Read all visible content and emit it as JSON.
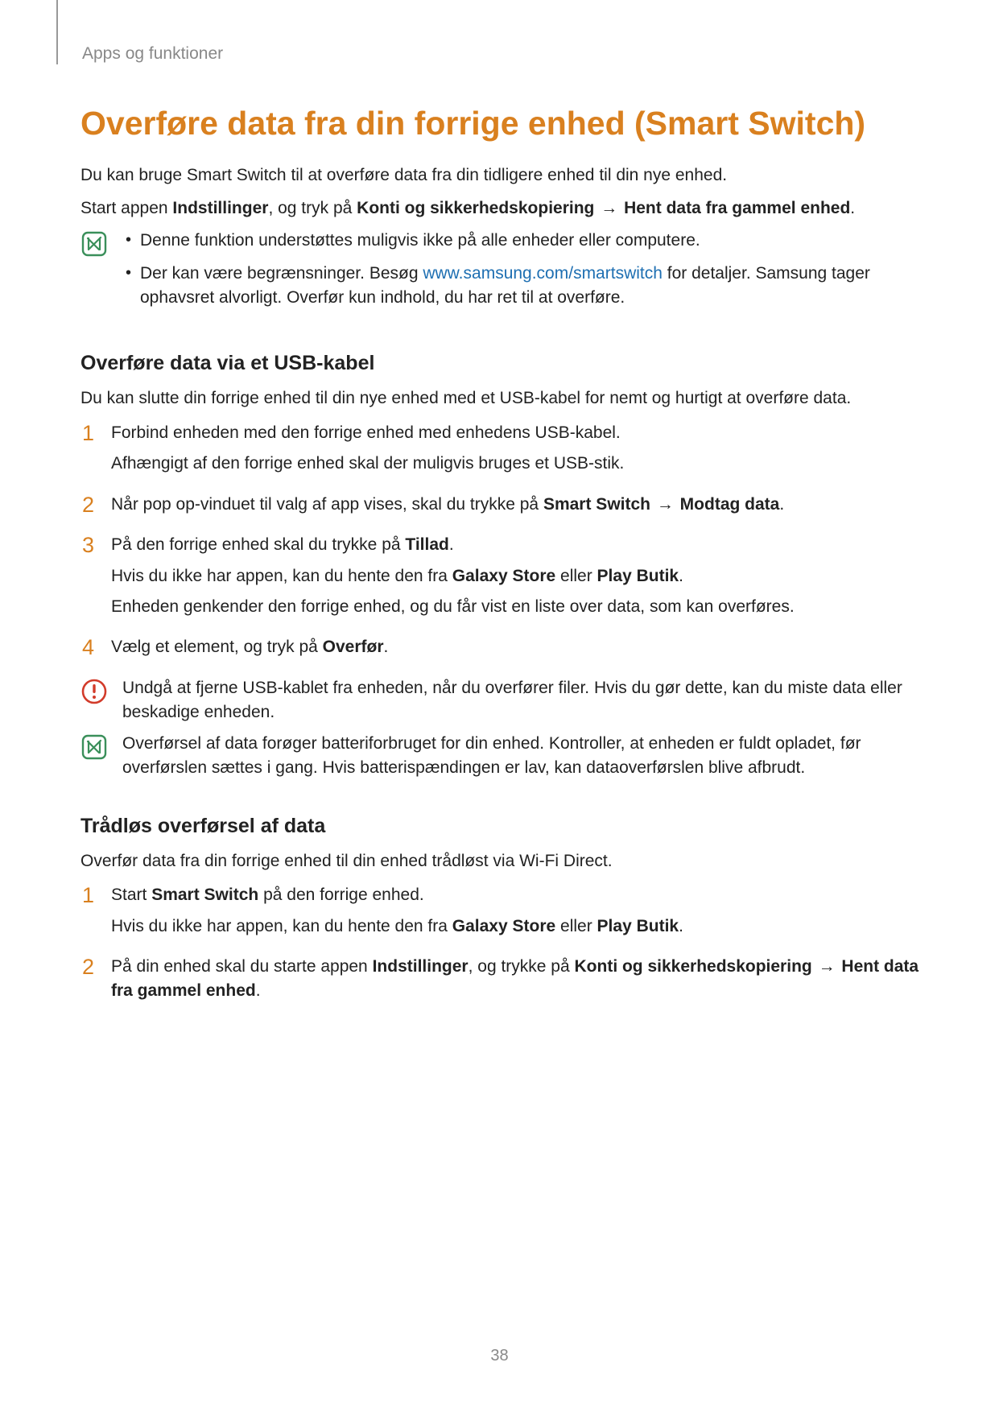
{
  "breadcrumb": "Apps og funktioner",
  "title": "Overføre data fra din forrige enhed (Smart Switch)",
  "intro1": "Du kan bruge Smart Switch til at overføre data fra din tidligere enhed til din nye enhed.",
  "intro2_pre": "Start appen ",
  "intro2_b1": "Indstillinger",
  "intro2_mid": ", og tryk på ",
  "intro2_b2": "Konti og sikkerhedskopiering",
  "arrow1": " → ",
  "intro2_b3": "Hent data fra gammel enhed",
  "intro2_end": ".",
  "note1_bullet1": "Denne funktion understøttes muligvis ikke på alle enheder eller computere.",
  "note1_bullet2_pre": "Der kan være begrænsninger. Besøg ",
  "note1_bullet2_link": "www.samsung.com/smartswitch",
  "note1_bullet2_post": " for detaljer. Samsung tager ophavsret alvorligt. Overfør kun indhold, du har ret til at overføre.",
  "section1_heading": "Overføre data via et USB-kabel",
  "section1_intro": "Du kan slutte din forrige enhed til din nye enhed med et USB-kabel for nemt og hurtigt at overføre data.",
  "s1_step1a": "Forbind enheden med den forrige enhed med enhedens USB-kabel.",
  "s1_step1b": "Afhængigt af den forrige enhed skal der muligvis bruges et USB-stik.",
  "s1_step2_pre": "Når pop op-vinduet til valg af app vises, skal du trykke på ",
  "s1_step2_b1": "Smart Switch",
  "s1_step2_arrow": " → ",
  "s1_step2_b2": "Modtag data",
  "s1_step2_end": ".",
  "s1_step3_pre": "På den forrige enhed skal du trykke på ",
  "s1_step3_b1": "Tillad",
  "s1_step3_mid": ".",
  "s1_step3_sub_pre": "Hvis du ikke har appen, kan du hente den fra ",
  "s1_step3_sub_b1": "Galaxy Store",
  "s1_step3_sub_mid": " eller ",
  "s1_step3_sub_b2": "Play Butik",
  "s1_step3_sub_end": ".",
  "s1_step3_sub2": "Enheden genkender den forrige enhed, og du får vist en liste over data, som kan overføres.",
  "s1_step4_pre": "Vælg et element, og tryk på ",
  "s1_step4_b1": "Overfør",
  "s1_step4_end": ".",
  "warn_text": "Undgå at fjerne USB-kablet fra enheden, når du overfører filer. Hvis du gør dette, kan du miste data eller beskadige enheden.",
  "note2_text": "Overførsel af data forøger batteriforbruget for din enhed. Kontroller, at enheden er fuldt opladet, før overførslen sættes i gang. Hvis batterispændingen er lav, kan dataoverførslen blive afbrudt.",
  "section2_heading": "Trådløs overførsel af data",
  "section2_intro": "Overfør data fra din forrige enhed til din enhed trådløst via Wi-Fi Direct.",
  "s2_step1_pre": "Start ",
  "s2_step1_b1": "Smart Switch",
  "s2_step1_post": " på den forrige enhed.",
  "s2_step1_sub_pre": "Hvis du ikke har appen, kan du hente den fra ",
  "s2_step1_sub_b1": "Galaxy Store",
  "s2_step1_sub_mid": " eller ",
  "s2_step1_sub_b2": "Play Butik",
  "s2_step1_sub_end": ".",
  "s2_step2_pre": "På din enhed skal du starte appen ",
  "s2_step2_b1": "Indstillinger",
  "s2_step2_mid": ", og trykke på ",
  "s2_step2_b2": "Konti og sikkerhedskopiering",
  "s2_step2_arrow": " → ",
  "s2_step2_b3": "Hent data fra gammel enhed",
  "s2_step2_end": ".",
  "page_number": "38"
}
